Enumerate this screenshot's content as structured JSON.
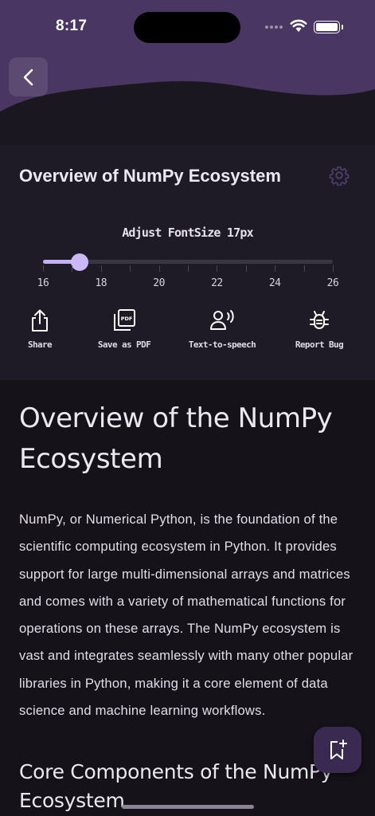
{
  "status_bar": {
    "time": "8:17"
  },
  "colors": {
    "header": "#4a3662",
    "accent": "#c4b1f0",
    "panel": "#1f1b26",
    "background": "#151219",
    "fab": "#3a2a52"
  },
  "icons": {
    "back": "chevron-left-icon",
    "settings": "gear-icon",
    "share": "share-icon",
    "pdf": "pdf-icon",
    "tts": "voice-icon",
    "bug": "bug-icon",
    "bookmark": "bookmark-add-icon"
  },
  "panel": {
    "title": "Overview of NumPy Ecosystem",
    "font_size_label": "Adjust FontSize 17px",
    "slider": {
      "min": 16,
      "max": 26,
      "value": 17,
      "ticks": [
        16,
        17,
        18,
        19,
        20,
        21,
        22,
        23,
        24,
        25,
        26
      ],
      "labels": [
        "16",
        "18",
        "20",
        "22",
        "24",
        "26"
      ]
    },
    "actions": [
      {
        "label": "Share"
      },
      {
        "label": "Save as PDF"
      },
      {
        "label": "Text-to-speech"
      },
      {
        "label": "Report Bug"
      }
    ]
  },
  "article": {
    "title": "Overview of the NumPy Ecosystem",
    "paragraph": "NumPy, or Numerical Python, is the foundation of the scientific computing ecosystem in Python. It provides support for large multi-dimensional arrays and matrices and comes with a variety of mathematical functions for operations on these arrays. The NumPy ecosystem is vast and integrates seamlessly with many other popular libraries in Python, making it a core element of data science and machine learning workflows.",
    "section_title": "Core Components of the NumPy Ecosystem"
  }
}
